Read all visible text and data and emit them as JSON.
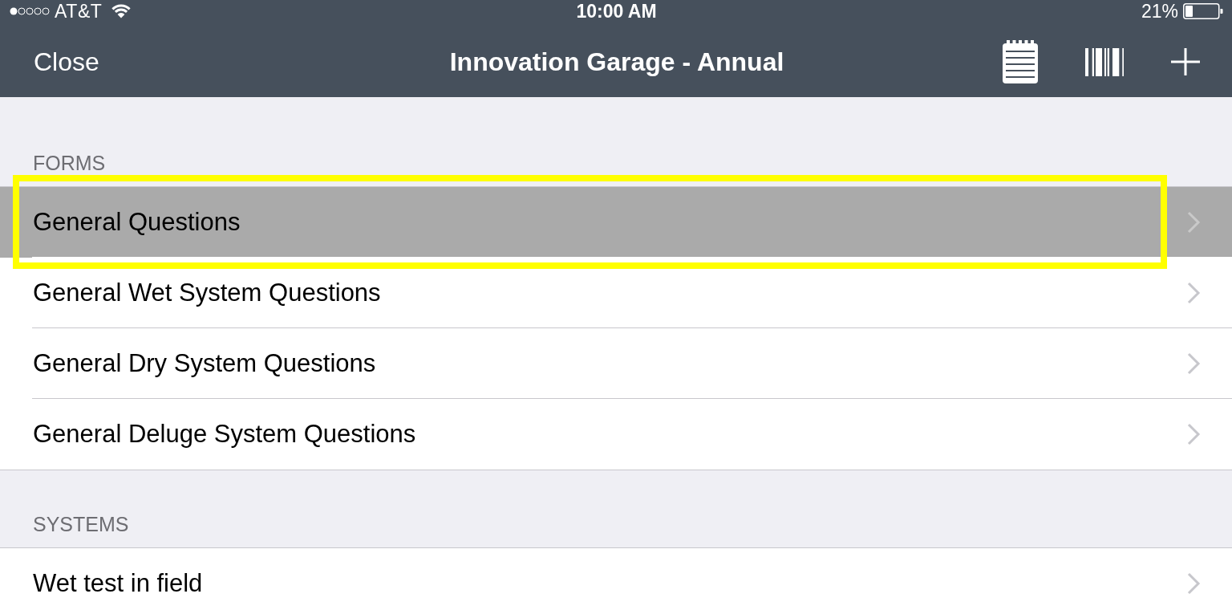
{
  "status_bar": {
    "carrier": "AT&T",
    "time": "10:00 AM",
    "battery": "21%"
  },
  "nav_bar": {
    "left_button": "Close",
    "title": "Innovation Garage - Annual",
    "actions": [
      {
        "kind": "notepad"
      },
      {
        "kind": "barcode"
      },
      {
        "kind": "add"
      }
    ]
  },
  "sections": [
    {
      "header": "FORMS",
      "items": [
        {
          "label": "General Questions",
          "selected": true,
          "highlighted": true
        },
        {
          "label": "General Wet System Questions",
          "selected": false,
          "highlighted": false
        },
        {
          "label": "General Dry System Questions",
          "selected": false,
          "highlighted": false
        },
        {
          "label": "General Deluge System Questions",
          "selected": false,
          "highlighted": false
        }
      ]
    },
    {
      "header": "SYSTEMS",
      "items": [
        {
          "label": "Wet test in field",
          "selected": false,
          "highlighted": false
        }
      ]
    }
  ]
}
